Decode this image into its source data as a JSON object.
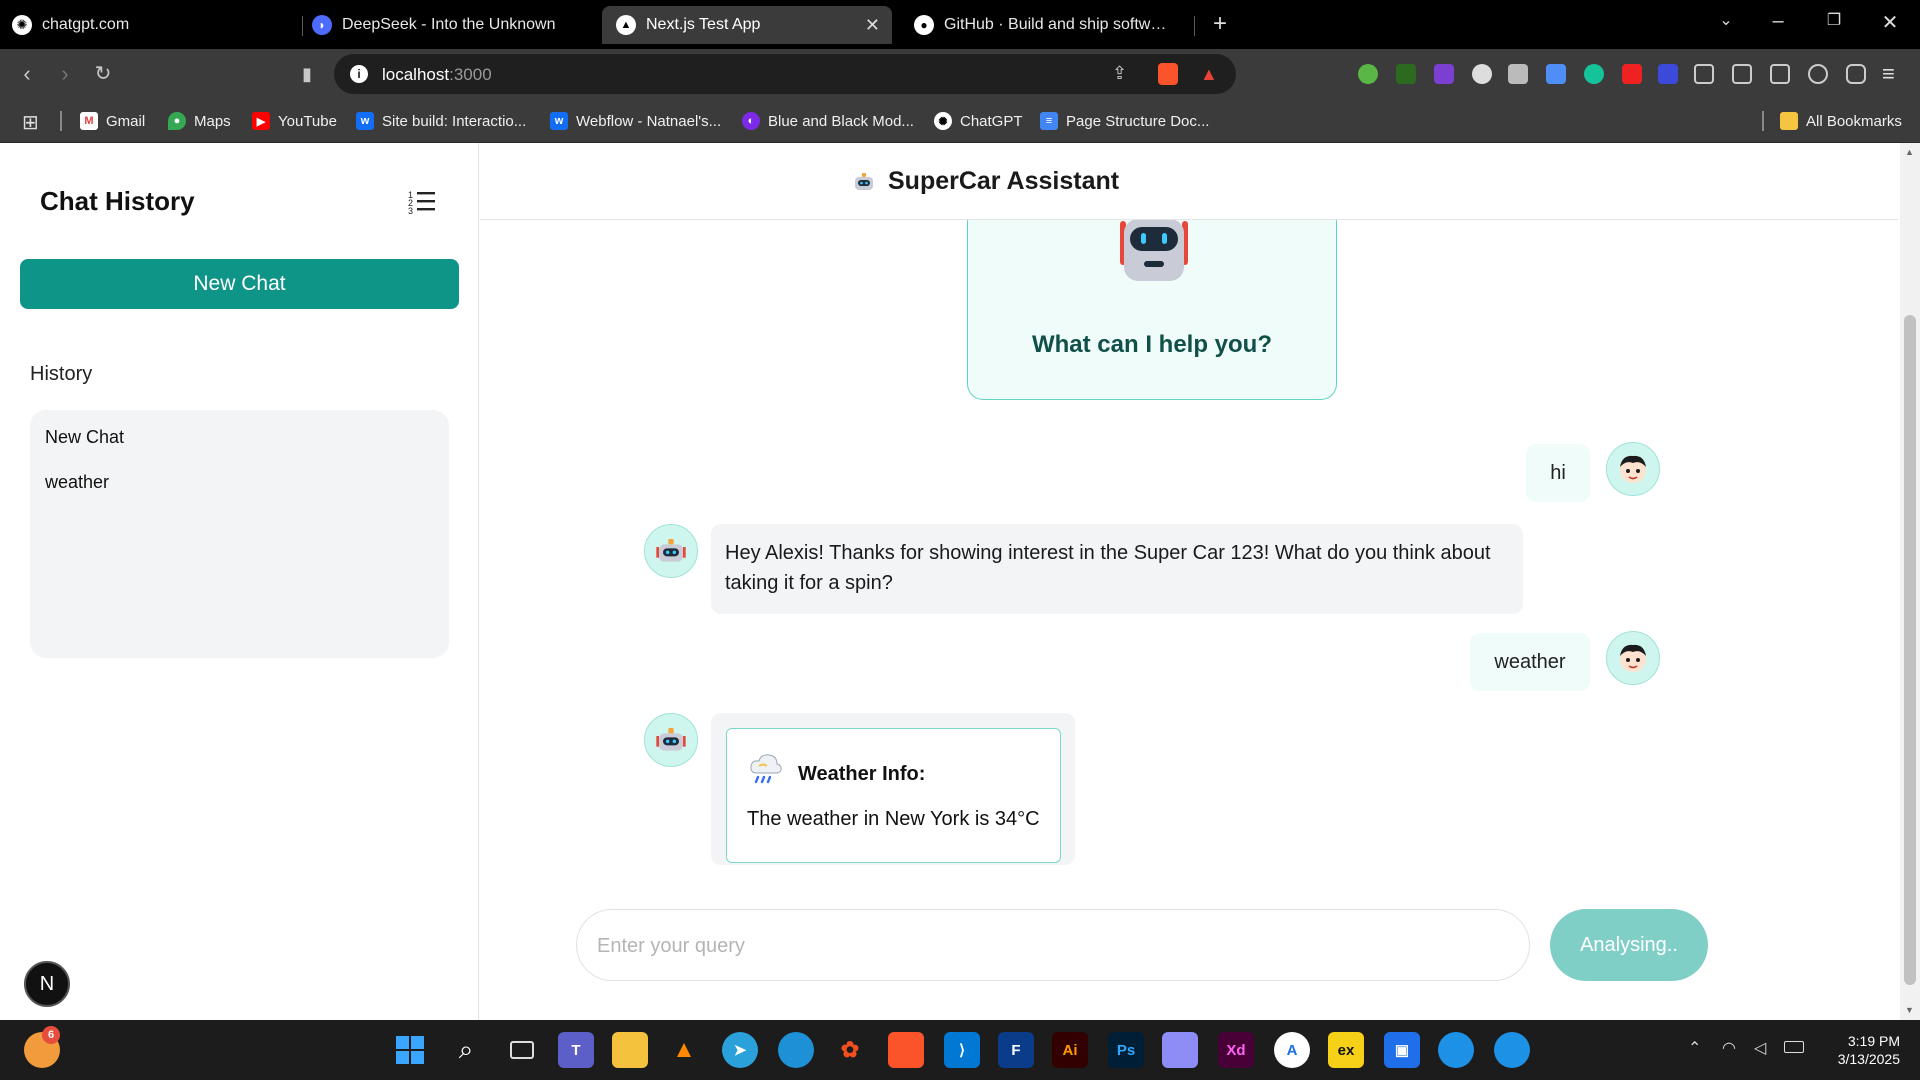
{
  "browser": {
    "tabs": [
      {
        "label": "chatgpt.com",
        "active": false
      },
      {
        "label": "DeepSeek - Into the Unknown",
        "active": false
      },
      {
        "label": "Next.js Test App",
        "active": true
      },
      {
        "label": "GitHub · Build and ship software on",
        "active": false
      }
    ],
    "url_host": "localhost",
    "url_port": ":3000",
    "bookmarks": [
      {
        "label": "Gmail",
        "icon": "gmail-icon"
      },
      {
        "label": "Maps",
        "icon": "maps-icon"
      },
      {
        "label": "YouTube",
        "icon": "youtube-icon"
      },
      {
        "label": "Site build: Interactio...",
        "icon": "webflow-icon"
      },
      {
        "label": "Webflow - Natnael's...",
        "icon": "webflow-icon"
      },
      {
        "label": "Blue and Black Mod...",
        "icon": "canva-icon"
      },
      {
        "label": "ChatGPT",
        "icon": "chatgpt-icon"
      },
      {
        "label": "Page Structure Doc...",
        "icon": "docs-icon"
      }
    ],
    "all_bookmarks": "All Bookmarks"
  },
  "sidebar": {
    "title": "Chat History",
    "new_chat": "New Chat",
    "history_label": "History",
    "history": [
      "New Chat",
      "weather"
    ],
    "badge": "N"
  },
  "chat": {
    "header_title": "SuperCar Assistant",
    "welcome": "What can I help you?",
    "messages": [
      {
        "role": "user",
        "text": "hi"
      },
      {
        "role": "bot",
        "text": "Hey Alexis! Thanks for showing interest in the Super Car 123! What do you think about taking it for a spin?"
      },
      {
        "role": "user",
        "text": "weather"
      },
      {
        "role": "bot",
        "card_title": "Weather Info:",
        "card_text": "The weather in New York is 34°C"
      }
    ],
    "input_placeholder": "Enter your query",
    "submit_label": "Analysing.."
  },
  "taskbar": {
    "time": "3:19 PM",
    "date": "3/13/2025",
    "notification_count": "6",
    "apps": [
      "Ai",
      "Ps",
      "Xd",
      "ex"
    ]
  },
  "colors": {
    "accent": "#0f9587",
    "accent_light": "#effcfa",
    "button_disabled": "#7fcfc7"
  }
}
